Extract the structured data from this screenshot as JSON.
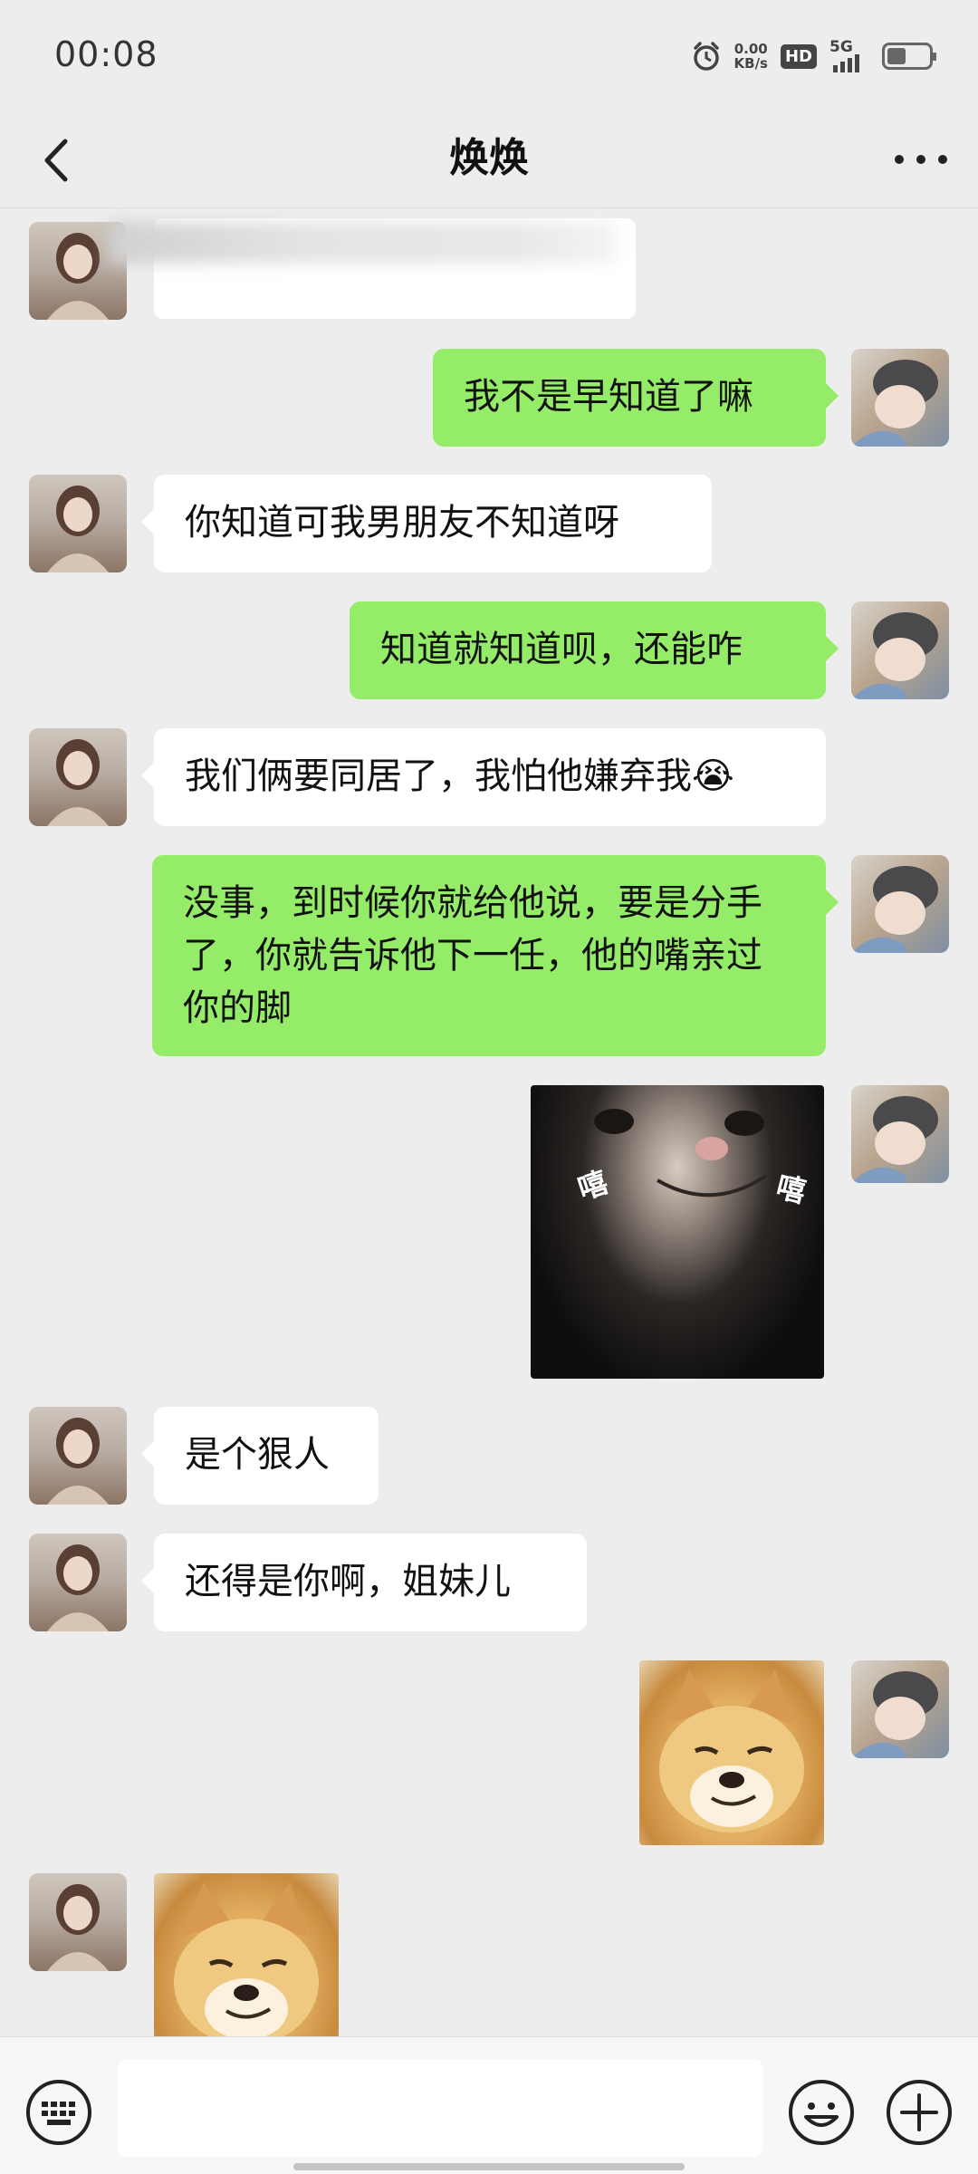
{
  "status_bar": {
    "time": "00:08",
    "speed_value": "0.00",
    "speed_unit": "KB/s",
    "hd_label": "HD",
    "network_label": "5G",
    "icons": [
      "alarm-icon",
      "signal-icon",
      "battery-icon"
    ]
  },
  "nav": {
    "title": "焕焕",
    "back_icon": "chevron-left-icon",
    "more_icon": "more-dots-icon"
  },
  "messages": [
    {
      "side": "left",
      "type": "text-blurred",
      "text": ""
    },
    {
      "side": "right",
      "type": "text",
      "text": "我不是早知道了嘛"
    },
    {
      "side": "left",
      "type": "text",
      "text": "你知道可我男朋友不知道呀"
    },
    {
      "side": "right",
      "type": "text",
      "text": "知道就知道呗，还能咋"
    },
    {
      "side": "left",
      "type": "text",
      "text": "我们俩要同居了，我怕他嫌弃我😭"
    },
    {
      "side": "right",
      "type": "text",
      "text": "没事，到时候你就给他说，要是分手了，你就告诉他下一任，他的嘴亲过你的脚"
    },
    {
      "side": "right",
      "type": "sticker",
      "sticker": "grinning-cat-sticker",
      "text_left": "嘻",
      "text_right": "嘻"
    },
    {
      "side": "left",
      "type": "text",
      "text": "是个狠人"
    },
    {
      "side": "left",
      "type": "text",
      "text": "还得是你啊，姐妹儿"
    },
    {
      "side": "right",
      "type": "sticker",
      "sticker": "doge-sticker"
    },
    {
      "side": "left",
      "type": "sticker",
      "sticker": "doge-sticker"
    }
  ],
  "input_bar": {
    "value": "",
    "placeholder": "",
    "icons": [
      "keyboard-icon",
      "emoji-icon",
      "plus-icon"
    ]
  },
  "colors": {
    "background": "#ededed",
    "sent_bubble": "#95ec69",
    "received_bubble": "#ffffff"
  }
}
